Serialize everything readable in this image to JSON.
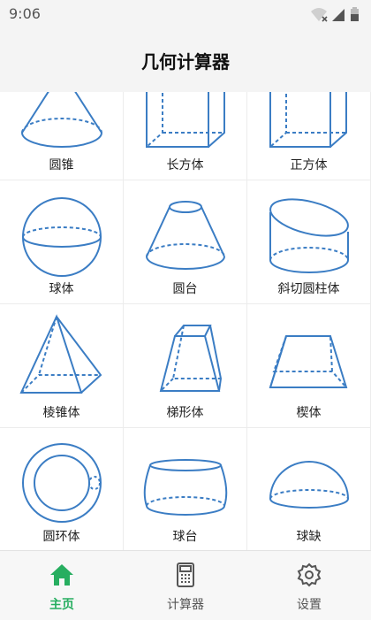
{
  "status": {
    "time": "9:06"
  },
  "header": {
    "title": "几何计算器"
  },
  "shapes": [
    {
      "label": "圆锥",
      "icon": "cone-icon"
    },
    {
      "label": "长方体",
      "icon": "cuboid-icon"
    },
    {
      "label": "正方体",
      "icon": "cube-icon"
    },
    {
      "label": "球体",
      "icon": "sphere-icon"
    },
    {
      "label": "圆台",
      "icon": "frustum-icon"
    },
    {
      "label": "斜切圆柱体",
      "icon": "oblique-cylinder-icon"
    },
    {
      "label": "棱锥体",
      "icon": "pyramid-icon"
    },
    {
      "label": "梯形体",
      "icon": "trapezoid-prism-icon"
    },
    {
      "label": "楔体",
      "icon": "wedge-icon"
    },
    {
      "label": "圆环体",
      "icon": "torus-icon"
    },
    {
      "label": "球台",
      "icon": "spherical-segment-icon"
    },
    {
      "label": "球缺",
      "icon": "spherical-cap-icon"
    }
  ],
  "nav": [
    {
      "label": "主页",
      "icon": "home-icon",
      "active": true
    },
    {
      "label": "计算器",
      "icon": "calculator-icon",
      "active": false
    },
    {
      "label": "设置",
      "icon": "settings-icon",
      "active": false
    }
  ],
  "colors": {
    "shape_stroke": "#3b7dc4",
    "accent": "#27ae60"
  }
}
